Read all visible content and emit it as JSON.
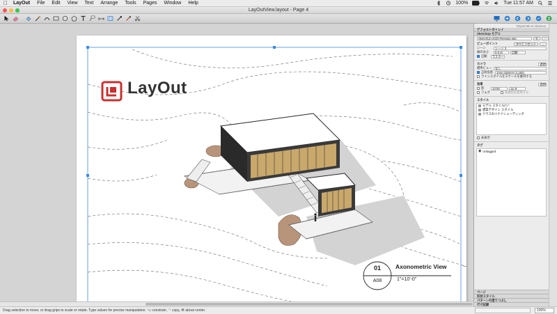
{
  "menubar": {
    "apple_icon": "apple-icon",
    "app_name": "LayOut",
    "items": [
      "File",
      "Edit",
      "View",
      "Text",
      "Arrange",
      "Tools",
      "Pages",
      "Window",
      "Help"
    ],
    "battery": "100%",
    "clock": "Tue 11:57 AM"
  },
  "window": {
    "title": "LayOutView.layout - Page 4",
    "traffic_colors": [
      "#fc5753",
      "#fdbc40",
      "#33c748"
    ]
  },
  "page": {
    "logo_text": "LayOut",
    "view_number": "01",
    "sheet_number": "A08",
    "view_title": "Axonometric View",
    "view_scale": "1\"=10'-0\""
  },
  "statusbar": {
    "hint": "Drag selection to move, or drag grips to scale or rotate. Type values for precise manipulation. ⌥ constrain, ⌃ copy, ⌘ about center.",
    "zoom": "100%"
  },
  "panel": {
    "top_label": "Report Me in Absence",
    "default_tray_title": "デフォルトのトレイ",
    "sketchup_header": "SketchUp モデル",
    "file_name": "SketchUp-2020-Release.skp",
    "viewpoint_label": "ビューポイント",
    "view_buttons": [
      "すべてリセット",
      "..."
    ],
    "scene_label": "シーン",
    "scene_value": "シーン 3",
    "line_weight_label": "線の太さ",
    "line_weight_value": "0.5 pt",
    "line_weight_unit": "自動",
    "auto_label": "自動",
    "render_btn": "ラスター",
    "camera_header": "カメラ",
    "apply_btn": "適用",
    "standard_view_label": "標準ビュー",
    "standard_view_value": "なし",
    "ortho_label": "正射投影",
    "ortho_value": "1mm:150mm (1:150)",
    "scale_check": "ラインスタイルをスケールを維持する",
    "effects_header": "効果",
    "apply_btn2": "適用",
    "shadow_label": "影",
    "shadow_time": "13:00",
    "shadow_date": "11/ 8",
    "fog_label": "フォグ",
    "bg_check": "背景色を使用する",
    "styles_header": "スタイル",
    "style_items": [
      "モデル スタイル(*) *",
      "建築デザイン スタイル",
      "クラスのバナドシェーディング"
    ],
    "hidden_label": "非表示",
    "tags_header": "タグ",
    "tag_items": [
      "Untagged"
    ],
    "collapsed": [
      "ページ",
      "形状スタイル",
      "パターンの塗りつぶし",
      "尺寸記録"
    ]
  }
}
